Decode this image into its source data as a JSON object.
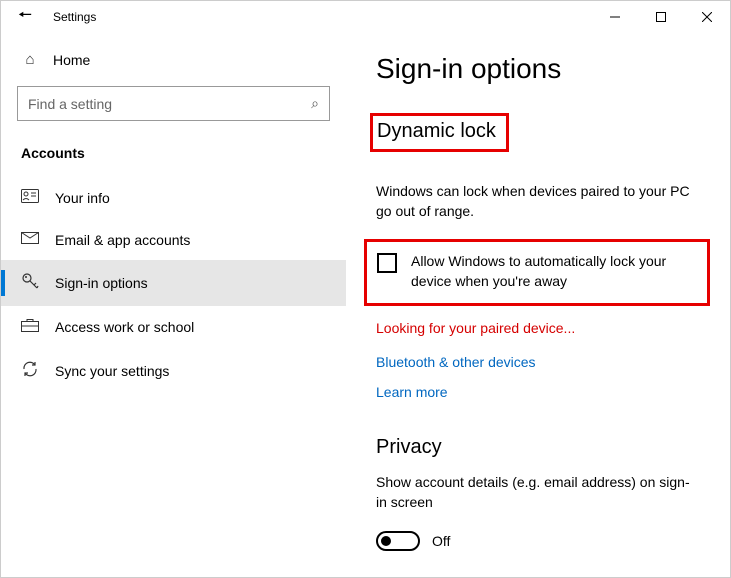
{
  "window": {
    "title": "Settings"
  },
  "nav": {
    "home": "Home",
    "search_placeholder": "Find a setting",
    "section": "Accounts",
    "items": [
      {
        "label": "Your info"
      },
      {
        "label": "Email & app accounts"
      },
      {
        "label": "Sign-in options"
      },
      {
        "label": "Access work or school"
      },
      {
        "label": "Sync your settings"
      }
    ]
  },
  "main": {
    "title": "Sign-in options",
    "dynamic_lock": {
      "heading": "Dynamic lock",
      "description": "Windows can lock when devices paired to your PC go out of range.",
      "checkbox_label": "Allow Windows to automatically lock your device when you're away",
      "status": "Looking for your paired device...",
      "link_bluetooth": "Bluetooth & other devices",
      "link_learn": "Learn more"
    },
    "privacy": {
      "heading": "Privacy",
      "description": "Show account details (e.g. email address) on sign-in screen",
      "toggle_state": "Off"
    }
  }
}
